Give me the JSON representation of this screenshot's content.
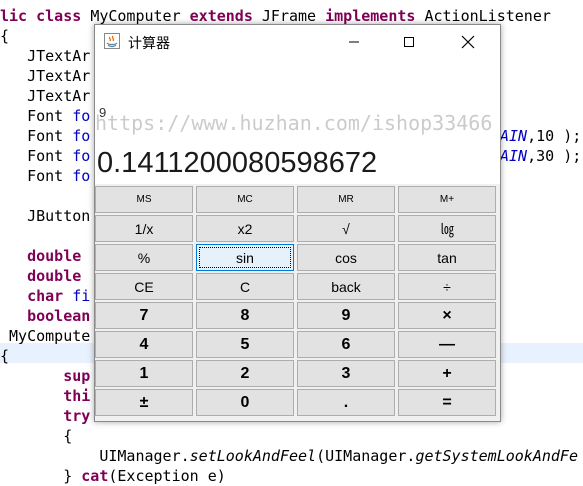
{
  "editor": {
    "lines": [
      {
        "segs": [
          {
            "t": "lic ",
            "c": "kw"
          },
          {
            "t": "class ",
            "c": "kw"
          },
          {
            "t": "MyComputer ",
            "c": "ty"
          },
          {
            "t": "extends ",
            "c": "kw"
          },
          {
            "t": "JFrame ",
            "c": "ty"
          },
          {
            "t": "implements ",
            "c": "kw"
          },
          {
            "t": "ActionListener",
            "c": "ty"
          }
        ]
      },
      {
        "segs": [
          {
            "t": "{",
            "c": "ty"
          }
        ]
      },
      {
        "segs": [
          {
            "t": "   JTextAr",
            "c": "ty"
          }
        ]
      },
      {
        "segs": [
          {
            "t": "   JTextAr",
            "c": "ty"
          }
        ]
      },
      {
        "segs": [
          {
            "t": "   JTextAr",
            "c": "ty"
          }
        ]
      },
      {
        "segs": [
          {
            "t": "   Font ",
            "c": "ty"
          },
          {
            "t": "fo",
            "c": "fd"
          }
        ]
      },
      {
        "segs": [
          {
            "t": "   Font ",
            "c": "ty"
          },
          {
            "t": "fo",
            "c": "fd"
          }
        ],
        "tail": [
          {
            "t": "AIN",
            "c": "it-blue"
          },
          {
            "t": ",10 );",
            "c": "ty"
          }
        ]
      },
      {
        "segs": [
          {
            "t": "   Font ",
            "c": "ty"
          },
          {
            "t": "fo",
            "c": "fd"
          }
        ],
        "tail": [
          {
            "t": "AIN",
            "c": "it-blue"
          },
          {
            "t": ",30 );",
            "c": "ty"
          }
        ]
      },
      {
        "segs": [
          {
            "t": "   Font ",
            "c": "ty"
          },
          {
            "t": "fo",
            "c": "fd"
          }
        ]
      },
      {
        "segs": [
          {
            "t": "",
            "c": "ty"
          }
        ]
      },
      {
        "segs": [
          {
            "t": "   JButton",
            "c": "ty"
          }
        ]
      },
      {
        "segs": [
          {
            "t": "",
            "c": "ty"
          }
        ]
      },
      {
        "segs": [
          {
            "t": "   double ",
            "c": "kw"
          }
        ]
      },
      {
        "segs": [
          {
            "t": "   double ",
            "c": "kw"
          }
        ]
      },
      {
        "segs": [
          {
            "t": "   char ",
            "c": "kw"
          },
          {
            "t": "fi",
            "c": "fd"
          }
        ]
      },
      {
        "segs": [
          {
            "t": "   boolean",
            "c": "kw"
          }
        ]
      },
      {
        "segs": [
          {
            "t": " MyCompute",
            "c": "ty"
          }
        ]
      },
      {
        "segs": [
          {
            "t": "{",
            "c": "ty"
          }
        ]
      },
      {
        "segs": [
          {
            "t": "       sup",
            "c": "kw"
          }
        ]
      },
      {
        "segs": [
          {
            "t": "       thi",
            "c": "kw"
          }
        ]
      },
      {
        "segs": [
          {
            "t": "       try",
            "c": "kw"
          }
        ]
      },
      {
        "segs": [
          {
            "t": "       {",
            "c": "ty"
          }
        ]
      },
      {
        "segs": [
          {
            "t": "           UIManager.",
            "c": "ty"
          },
          {
            "t": "setLookAndFeel",
            "c": "it"
          },
          {
            "t": "(UIManager.",
            "c": "ty"
          },
          {
            "t": "getSystemLookAndFe",
            "c": "it"
          }
        ]
      },
      {
        "segs": [
          {
            "t": "       } ",
            "c": "ty"
          },
          {
            "t": "cat",
            "c": "kw"
          },
          {
            "t": "(Exception e)",
            "c": "ty"
          }
        ]
      }
    ]
  },
  "window": {
    "title": "计算器",
    "minimize": "—",
    "maximize": "☐",
    "close": "✕"
  },
  "display": {
    "expression": "9",
    "result": "0.1411200080598672"
  },
  "watermark": "https://www.huzhan.com/ishop33466",
  "keys": [
    [
      "MS",
      "MC",
      "MR",
      "M+"
    ],
    [
      "1/x",
      "x2",
      "√",
      "㏒"
    ],
    [
      "%",
      "sin",
      "cos",
      "tan"
    ],
    [
      "CE",
      "C",
      "back",
      "÷"
    ],
    [
      "7",
      "8",
      "9",
      "×"
    ],
    [
      "4",
      "5",
      "6",
      "—"
    ],
    [
      "1",
      "2",
      "3",
      "+"
    ],
    [
      "±",
      "0",
      ".",
      "="
    ]
  ],
  "colors": {
    "keyword": "#7f0055",
    "field": "#0000c0",
    "focus_border": "#0078d7"
  }
}
